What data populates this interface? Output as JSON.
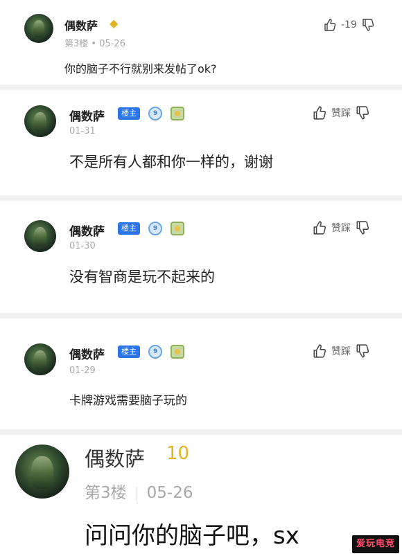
{
  "comments": [
    {
      "author": "偶数萨",
      "floor_meta": "第3楼 • 05-26",
      "vote_count": "-19",
      "text": "你的脑子不行就别来发帖了ok?"
    },
    {
      "author": "偶数萨",
      "host_badge": "楼主",
      "level": "9",
      "date": "01-31",
      "vote_label": "赞踩",
      "text": "不是所有人都和你一样的，谢谢"
    },
    {
      "author": "偶数萨",
      "host_badge": "楼主",
      "level": "9",
      "date": "01-30",
      "vote_label": "赞踩",
      "text": "没有智商是玩不起来的"
    },
    {
      "author": "偶数萨",
      "host_badge": "楼主",
      "level": "9",
      "date": "01-29",
      "vote_label": "赞踩",
      "text": "卡牌游戏需要脑子玩的"
    }
  ],
  "zoomed": {
    "author": "偶数萨",
    "level": "10",
    "floor": "第3楼",
    "date": "05-26",
    "text": "问问你的脑子吧，sx"
  },
  "watermark": "爱玩电竞",
  "icons": [
    "thumbs-up-icon",
    "thumbs-down-icon",
    "level-badge-icon",
    "medal-icon",
    "gold-level-icon"
  ],
  "colors": {
    "host_badge": "#2d74e6",
    "meta": "#a8a8a8",
    "gold": "#e3b21f"
  }
}
